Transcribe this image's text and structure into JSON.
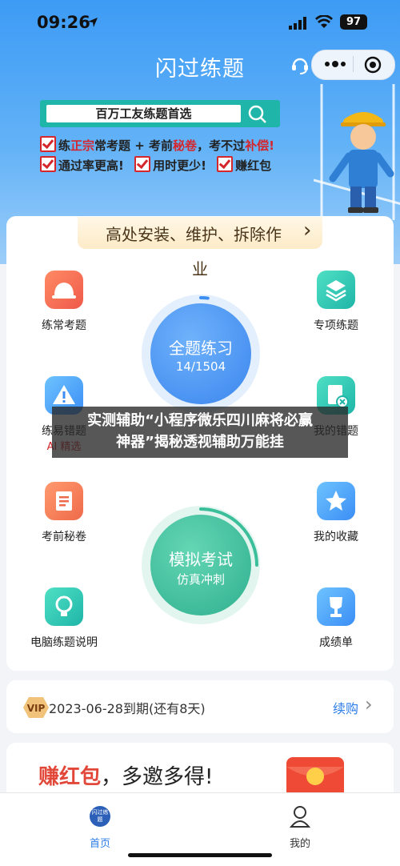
{
  "status_bar": {
    "time": "09:26",
    "battery": "97"
  },
  "nav": {
    "title": "闪过练题"
  },
  "banner": {
    "title": "百万工友练题首选",
    "line1_a": "练",
    "line1_b": "正宗",
    "line1_c": "常考题 + 考前",
    "line1_d": "秘卷",
    "line1_e": "，考不过",
    "line1_f": "补偿!",
    "line2_a": "通过率更高!",
    "line2_b": "用时更少!",
    "line2_c": "赚红包"
  },
  "category": {
    "text_line1": "高处安装、维护、拆除作",
    "text_line2": "业",
    "arrow": "›"
  },
  "tiles": {
    "common": "练常考题",
    "special": "专项练题",
    "easy_wrong": "练易错题",
    "easy_wrong_sub": "AI 精选",
    "my_wrong": "我的错题",
    "secret": "考前秘卷",
    "favorites": "我的收藏",
    "computer": "电脑练题说明",
    "scores": "成绩单"
  },
  "practice": {
    "title": "全题练习",
    "progress": "14/1504",
    "progress_fraction": 0.0093
  },
  "mock": {
    "title": "模拟考试",
    "subtitle": "仿真冲刺"
  },
  "vip": {
    "badge": "VIP",
    "expiry": "2023-06-28到期(还有8天)",
    "renew": "续购",
    "arrow": "›"
  },
  "promo": {
    "text_red": "赚红包",
    "text_rest": "，多邀多得!"
  },
  "overlay": {
    "line1": "实测辅助“小程序微乐四川麻将必赢",
    "line2": "神器”揭秘透视辅助万能挂"
  },
  "tabbar": {
    "home": "首页",
    "home_icon_text": "闪过练题",
    "mine": "我的"
  },
  "colors": {
    "primary": "#3d9bf5",
    "accent_red": "#d4262b",
    "teal": "#1fb5a8",
    "tab_active": "#2b7de9"
  }
}
